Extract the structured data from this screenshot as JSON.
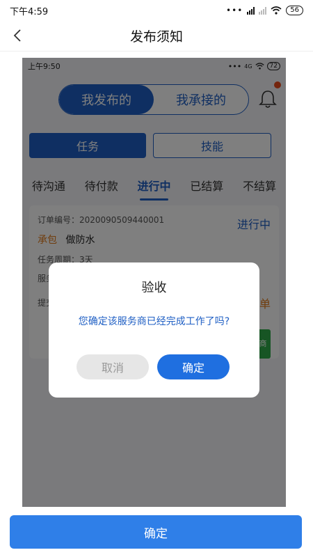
{
  "status_bar": {
    "time": "下午4:59",
    "battery": "56"
  },
  "header": {
    "back_icon": "chevron-left-icon",
    "title": "发布须知"
  },
  "embedded": {
    "status_time": "上午9:50",
    "status_network": "4G",
    "status_battery": "72",
    "segments": {
      "active": "我发布的",
      "inactive": "我承接的"
    },
    "bell_icon": "bell-icon",
    "type_tabs": {
      "active": "任务",
      "inactive": "技能"
    },
    "status_tabs": [
      "待沟通",
      "待付款",
      "进行中",
      "已结算",
      "不结算"
    ],
    "active_status_index": 2,
    "card": {
      "order_no": "订单编号：2020090509440001",
      "state": "进行中",
      "tag": "承包",
      "title": "做防水",
      "line_task_cycle": "任务周期：3天",
      "line_service": "服务",
      "line_submit": "提交",
      "right_orange": "单",
      "green_button_text": "商"
    },
    "dialog": {
      "title": "验收",
      "message": "您确定该服务商已经完成工作了吗?",
      "cancel": "取消",
      "confirm": "确定"
    }
  },
  "bottom_button": "确定",
  "colors": {
    "primary": "#1f5fc4",
    "confirm_blue": "#2f7fe8",
    "orange": "#e07a1a",
    "green": "#2eab48"
  }
}
